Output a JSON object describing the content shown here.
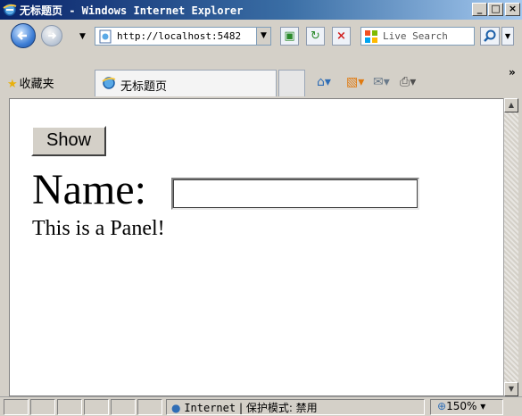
{
  "window": {
    "title": "无标题页 - Windows Internet Explorer",
    "minimize": "_",
    "maximize": "□",
    "close": "×"
  },
  "address_bar": {
    "url": "http://localhost:5482",
    "search_placeholder": "Live Search"
  },
  "favorites_bar": {
    "favorites_label": "收藏夹",
    "tab_title": "无标题页"
  },
  "page": {
    "show_button": "Show",
    "name_label": "Name:",
    "name_value": "",
    "panel_text": "This is a Panel!"
  },
  "status_bar": {
    "zone": "Internet",
    "protected_mode": "保护模式: 禁用",
    "zoom": "150%"
  },
  "colors": {
    "title_bar_start": "#0a246a",
    "title_bar_end": "#a6caf0",
    "chrome": "#d4d0c8"
  }
}
